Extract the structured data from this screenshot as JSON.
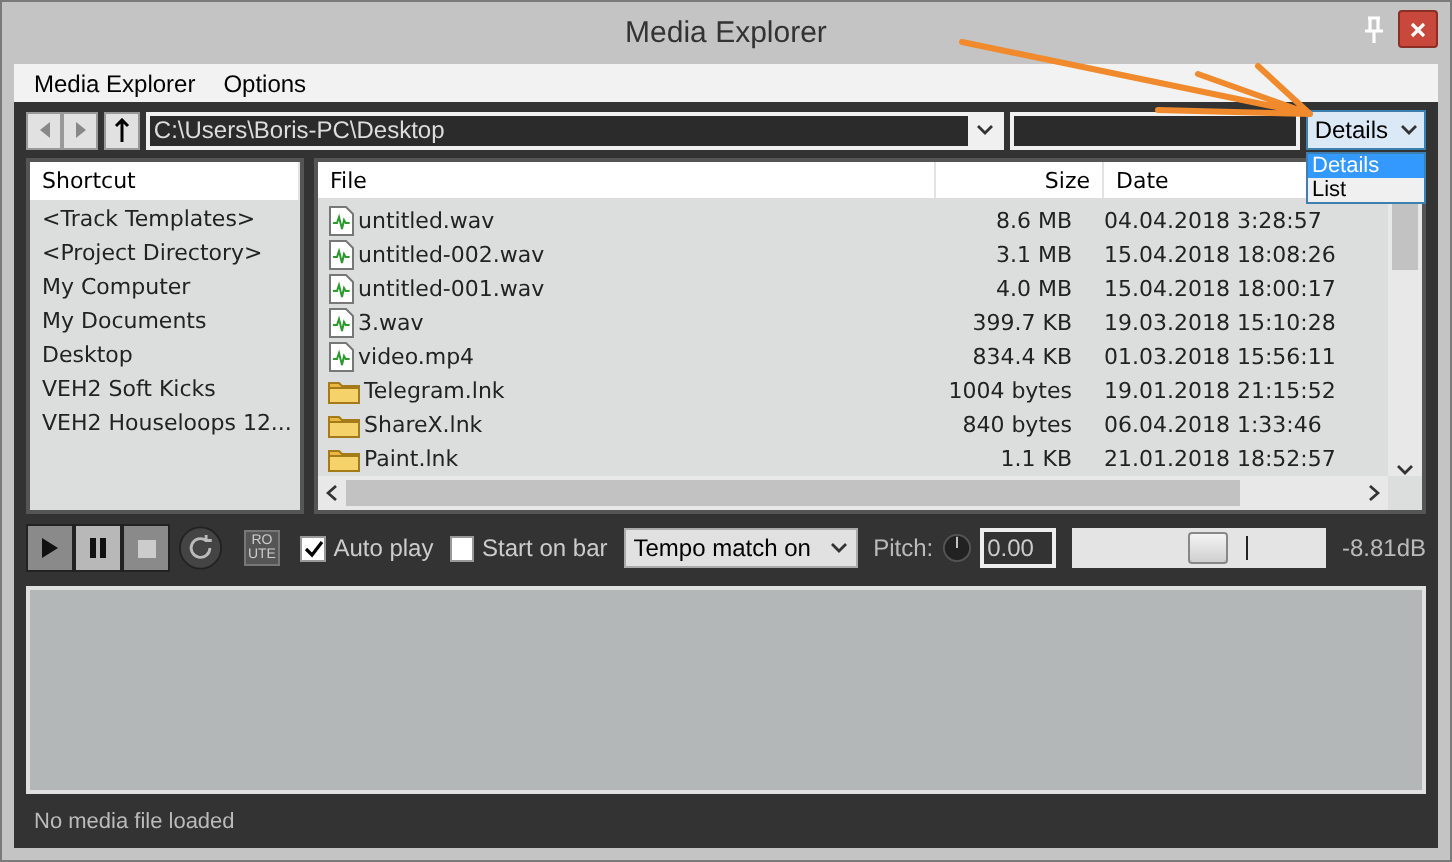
{
  "window": {
    "title": "Media Explorer"
  },
  "menu": [
    "Media Explorer",
    "Options"
  ],
  "toolbar": {
    "path": "C:\\Users\\Boris-PC\\Desktop",
    "view": "Details",
    "view_options": [
      {
        "label": "Details",
        "selected": true
      },
      {
        "label": "List",
        "selected": false
      }
    ]
  },
  "shortcuts": {
    "heading": "Shortcut",
    "items": [
      "<Track Templates>",
      "<Project Directory>",
      "My Computer",
      "My Documents",
      "Desktop",
      "VEH2 Soft Kicks",
      "VEH2 Houseloops 12..."
    ]
  },
  "files": {
    "columns": [
      "File",
      "Size",
      "Date"
    ],
    "rows": [
      {
        "kind": "audio",
        "name": "untitled.wav",
        "size": "8.6 MB",
        "date": "04.04.2018 3:28:57"
      },
      {
        "kind": "audio",
        "name": "untitled-002.wav",
        "size": "3.1 MB",
        "date": "15.04.2018 18:08:26"
      },
      {
        "kind": "audio",
        "name": "untitled-001.wav",
        "size": "4.0 MB",
        "date": "15.04.2018 18:00:17"
      },
      {
        "kind": "audio",
        "name": "3.wav",
        "size": "399.7 KB",
        "date": "19.03.2018 15:10:28"
      },
      {
        "kind": "audio",
        "name": "video.mp4",
        "size": "834.4 KB",
        "date": "01.03.2018 15:56:11"
      },
      {
        "kind": "folder",
        "name": "Telegram.lnk",
        "size": "1004 bytes",
        "date": "19.01.2018 21:15:52"
      },
      {
        "kind": "folder",
        "name": "ShareX.lnk",
        "size": "840 bytes",
        "date": "06.04.2018 1:33:46"
      },
      {
        "kind": "folder",
        "name": "Paint.lnk",
        "size": "1.1 KB",
        "date": "21.01.2018 18:52:57"
      }
    ]
  },
  "transport": {
    "route": "RO UTE",
    "auto_play": {
      "label": "Auto play",
      "checked": true
    },
    "start_on_bar": {
      "label": "Start on bar",
      "checked": false
    },
    "tempo": "Tempo match on",
    "pitch_label": "Pitch:",
    "pitch": "0.00",
    "volume": {
      "level": 0.54,
      "reading": "-8.81dB"
    }
  },
  "status": "No media file loaded"
}
